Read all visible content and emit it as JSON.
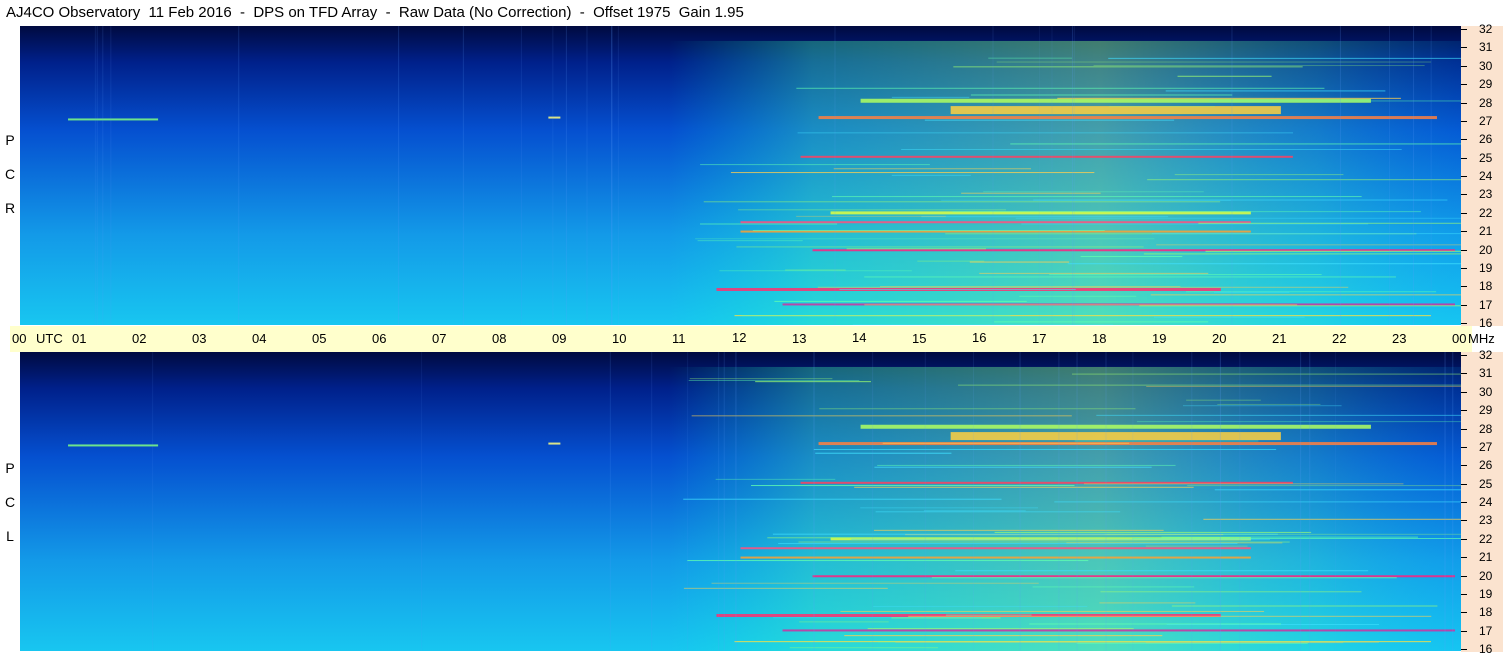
{
  "header": {
    "title": "AJ4CO Observatory  11 Feb 2016  -  DPS on TFD Array  -  Raw Data (No Correction)  -  Offset 1975  Gain 1.95"
  },
  "panels": {
    "rcp_label": [
      "R",
      "C",
      "P"
    ],
    "lcp_label": [
      "L",
      "C",
      "P"
    ]
  },
  "time_axis": {
    "labels": [
      "00",
      "01",
      "02",
      "03",
      "04",
      "05",
      "06",
      "07",
      "08",
      "09",
      "10",
      "11",
      "12",
      "13",
      "14",
      "15",
      "16",
      "17",
      "18",
      "19",
      "20",
      "21",
      "22",
      "23",
      "00"
    ],
    "start_unit": "UTC",
    "end_unit": "MHz"
  },
  "freq_axis": {
    "labels": [
      "32",
      "31",
      "30",
      "29",
      "28",
      "27",
      "26",
      "25",
      "24",
      "23",
      "22",
      "21",
      "20",
      "19",
      "18",
      "17",
      "16"
    ]
  },
  "colors": {
    "background": "#ffffff",
    "time_axis_bg": "#ffffcc",
    "freq_axis_bg": "#fbe3cf",
    "spectrogram_base": "#1a8fe6"
  },
  "chart_data": {
    "type": "heatmap",
    "title": "AJ4CO Observatory  11 Feb 2016  -  DPS on TFD Array  -  Raw Data (No Correction)  -  Offset 1975  Gain 1.95",
    "xlabel": "UTC",
    "ylabel": "MHz",
    "xlim": [
      0,
      24
    ],
    "ylim": [
      16,
      32
    ],
    "panels": [
      "RCP",
      "LCP"
    ],
    "colormap": "jet",
    "bright_bands_mhz": [
      17,
      18,
      20,
      21,
      22,
      25,
      27,
      28
    ]
  }
}
